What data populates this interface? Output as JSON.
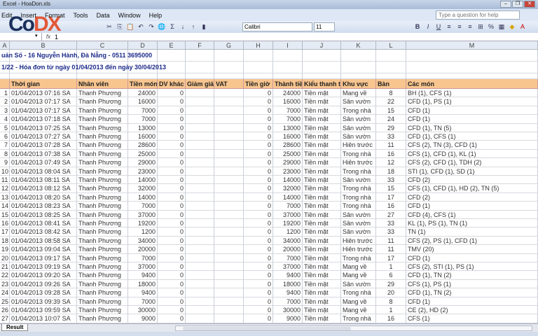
{
  "window": {
    "title": "Excel - HoaDon.xls"
  },
  "logo": "CoDX",
  "menu": [
    "Edit",
    "Insert",
    "Format",
    "Tools",
    "Data",
    "Window",
    "Help"
  ],
  "help_placeholder": "Type a question for help",
  "toolbar": {
    "font": "Calibri",
    "size": "11"
  },
  "formula_bar": {
    "fx": "fx",
    "value": "1"
  },
  "columns": [
    "A",
    "B",
    "C",
    "D",
    "E",
    "F",
    "G",
    "H",
    "I",
    "J",
    "K",
    "L",
    "M"
  ],
  "title_line1": "uán Số  -  16 Nguyễn Hành, Đà Nẵng  -  0511 3695000",
  "title_line2": "1/22 - Hóa đơn từ ngày 01/04/2013 đến ngày 30/04/2013",
  "headers": [
    "",
    "Thời gian",
    "Nhân viên",
    "Tiền món",
    "DV khác",
    "Giảm giá",
    "VAT",
    "Tiền giờ",
    "Thành tiền",
    "Kiểu thanh toán",
    "Khu vực",
    "Bàn",
    "Các món"
  ],
  "rows": [
    [
      "1",
      "01/04/2013 07:16 SA",
      "Thanh Phương",
      "24000",
      "0",
      "",
      "",
      "0",
      "24000",
      "Tiền mặt",
      "Mang về",
      "8",
      "BH (1), CFS (1)"
    ],
    [
      "2",
      "01/04/2013 07:17 SA",
      "Thanh Phương",
      "16000",
      "0",
      "",
      "",
      "0",
      "16000",
      "Tiền mặt",
      "Sân vườn",
      "22",
      "CFD (1), PS (1)"
    ],
    [
      "3",
      "01/04/2013 07:17 SA",
      "Thanh Phương",
      "7000",
      "0",
      "",
      "",
      "0",
      "7000",
      "Tiền mặt",
      "Trong nhà",
      "15",
      "CFD (1)"
    ],
    [
      "4",
      "01/04/2013 07:18 SA",
      "Thanh Phương",
      "7000",
      "0",
      "",
      "",
      "0",
      "7000",
      "Tiền mặt",
      "Sân vườn",
      "24",
      "CFD (1)"
    ],
    [
      "5",
      "01/04/2013 07:25 SA",
      "Thanh Phương",
      "13000",
      "0",
      "",
      "",
      "0",
      "13000",
      "Tiền mặt",
      "Sân vườn",
      "29",
      "CFD (1), TN (5)"
    ],
    [
      "6",
      "01/04/2013 07:27 SA",
      "Thanh Phương",
      "16000",
      "0",
      "",
      "",
      "0",
      "16000",
      "Tiền mặt",
      "Sân vườn",
      "33",
      "CFD (1), CFS (1)"
    ],
    [
      "7",
      "01/04/2013 07:28 SA",
      "Thanh Phương",
      "28600",
      "0",
      "",
      "",
      "0",
      "28600",
      "Tiền mặt",
      "Hiên trước",
      "11",
      "CFS (2), TN (3), CFD (1)"
    ],
    [
      "8",
      "01/04/2013 07:38 SA",
      "Thanh Phương",
      "25000",
      "0",
      "",
      "",
      "0",
      "25000",
      "Tiền mặt",
      "Trong nhà",
      "16",
      "CFS (1), CFD (1), KL (1)"
    ],
    [
      "9",
      "01/04/2013 07:49 SA",
      "Thanh Phương",
      "29000",
      "0",
      "",
      "",
      "0",
      "29000",
      "Tiền mặt",
      "Hiên trước",
      "12",
      "CFS (2), CFD (1), TDH (2)"
    ],
    [
      "10",
      "01/04/2013 08:04 SA",
      "Thanh Phương",
      "23000",
      "0",
      "",
      "",
      "0",
      "23000",
      "Tiền mặt",
      "Trong nhà",
      "18",
      "STI (1), CFD (1), SD (1)"
    ],
    [
      "11",
      "01/04/2013 08:11 SA",
      "Thanh Phương",
      "14000",
      "0",
      "",
      "",
      "0",
      "14000",
      "Tiền mặt",
      "Sân vườn",
      "33",
      "CFD (2)"
    ],
    [
      "12",
      "01/04/2013 08:12 SA",
      "Thanh Phương",
      "32000",
      "0",
      "",
      "",
      "0",
      "32000",
      "Tiền mặt",
      "Trong nhà",
      "15",
      "CFS (1), CFD (1), HD (2), TN (5)"
    ],
    [
      "13",
      "01/04/2013 08:20 SA",
      "Thanh Phương",
      "14000",
      "0",
      "",
      "",
      "0",
      "14000",
      "Tiền mặt",
      "Trong nhà",
      "17",
      "CFD (2)"
    ],
    [
      "14",
      "01/04/2013 08:23 SA",
      "Thanh Phương",
      "7000",
      "0",
      "",
      "",
      "0",
      "7000",
      "Tiền mặt",
      "Trong nhà",
      "16",
      "CFD (1)"
    ],
    [
      "15",
      "01/04/2013 08:25 SA",
      "Thanh Phương",
      "37000",
      "0",
      "",
      "",
      "0",
      "37000",
      "Tiền mặt",
      "Sân vườn",
      "27",
      "CFD (4), CFS (1)"
    ],
    [
      "16",
      "01/04/2013 08:41 SA",
      "Thanh Phương",
      "19200",
      "0",
      "",
      "",
      "0",
      "19200",
      "Tiền mặt",
      "Sân vườn",
      "33",
      "KL (1), PS (1), TN (1)"
    ],
    [
      "17",
      "01/04/2013 08:42 SA",
      "Thanh Phương",
      "1200",
      "0",
      "",
      "",
      "0",
      "1200",
      "Tiền mặt",
      "Sân vườn",
      "33",
      "TN (1)"
    ],
    [
      "18",
      "01/04/2013 08:58 SA",
      "Thanh Phương",
      "34000",
      "0",
      "",
      "",
      "0",
      "34000",
      "Tiền mặt",
      "Hiên trước",
      "11",
      "CFS (2), PS (1), CFD (1)"
    ],
    [
      "19",
      "01/04/2013 09:04 SA",
      "Thanh Phương",
      "20000",
      "0",
      "",
      "",
      "0",
      "20000",
      "Tiền mặt",
      "Hiên trước",
      "11",
      "TMV (20)"
    ],
    [
      "20",
      "01/04/2013 09:17 SA",
      "Thanh Phương",
      "7000",
      "0",
      "",
      "",
      "0",
      "7000",
      "Tiền mặt",
      "Trong nhà",
      "17",
      "CFD (1)"
    ],
    [
      "21",
      "01/04/2013 09:19 SA",
      "Thanh Phương",
      "37000",
      "0",
      "",
      "",
      "0",
      "37000",
      "Tiền mặt",
      "Mang về",
      "1",
      "CFS (2), STI (1), PS (1)"
    ],
    [
      "22",
      "01/04/2013 09:20 SA",
      "Thanh Phương",
      "9400",
      "0",
      "",
      "",
      "0",
      "9400",
      "Tiền mặt",
      "Mang về",
      "6",
      "CFD (1), TN (2)"
    ],
    [
      "23",
      "01/04/2013 09:26 SA",
      "Thanh Phương",
      "18000",
      "0",
      "",
      "",
      "0",
      "18000",
      "Tiền mặt",
      "Sân vườn",
      "29",
      "CFS (1), PS (1)"
    ],
    [
      "24",
      "01/04/2013 09:28 SA",
      "Thanh Phương",
      "9400",
      "0",
      "",
      "",
      "0",
      "9400",
      "Tiền mặt",
      "Trong nhà",
      "20",
      "CFD (1), TN (2)"
    ],
    [
      "25",
      "01/04/2013 09:39 SA",
      "Thanh Phương",
      "7000",
      "0",
      "",
      "",
      "0",
      "7000",
      "Tiền mặt",
      "Mang về",
      "8",
      "CFD (1)"
    ],
    [
      "26",
      "01/04/2013 09:59 SA",
      "Thanh Phương",
      "30000",
      "0",
      "",
      "",
      "0",
      "30000",
      "Tiền mặt",
      "Mang về",
      "1",
      "CE (2), HD (2)"
    ],
    [
      "27",
      "01/04/2013 10:07 SA",
      "Thanh Phương",
      "9000",
      "0",
      "",
      "",
      "0",
      "9000",
      "Tiền mặt",
      "Trong nhà",
      "16",
      "CFS (1)"
    ]
  ],
  "sheet_tab": "Result"
}
